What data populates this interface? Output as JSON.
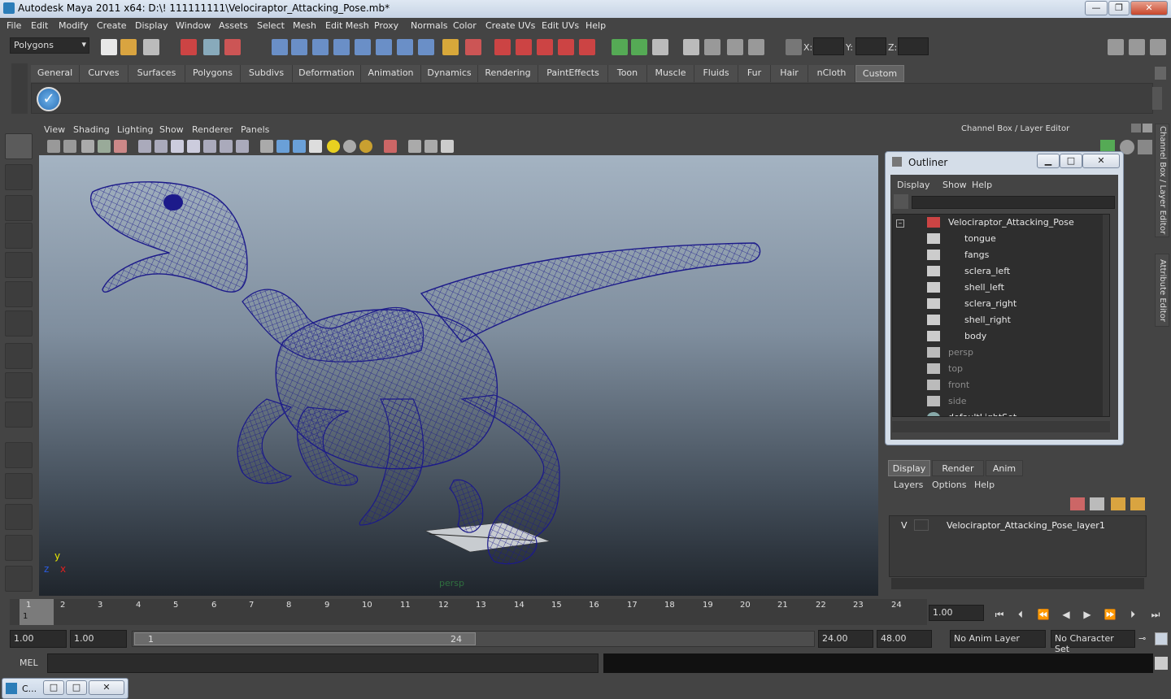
{
  "window": {
    "title": "Autodesk Maya 2011 x64: D:\\! 111111111\\Velociraptor_Attacking_Pose.mb*",
    "min_label": "—",
    "max_label": "❐",
    "close_label": "✕"
  },
  "menubar": [
    "File",
    "Edit",
    "Modify",
    "Create",
    "Display",
    "Window",
    "Assets",
    "Select",
    "Mesh",
    "Edit Mesh",
    "Proxy",
    "Normals",
    "Color",
    "Create UVs",
    "Edit UVs",
    "Help"
  ],
  "status": {
    "mode_menu": "Polygons",
    "x_label": "X:",
    "y_label": "Y:",
    "z_label": "Z:"
  },
  "shelf": {
    "tabs": [
      "General",
      "Curves",
      "Surfaces",
      "Polygons",
      "Subdivs",
      "Deformation",
      "Animation",
      "Dynamics",
      "Rendering",
      "PaintEffects",
      "Toon",
      "Muscle",
      "Fluids",
      "Fur",
      "Hair",
      "nCloth",
      "Custom"
    ],
    "active_tab": "Custom"
  },
  "viewport": {
    "menu": [
      "View",
      "Shading",
      "Lighting",
      "Show",
      "Renderer",
      "Panels"
    ],
    "camera_label": "persp",
    "axis_y": "y",
    "axis_x": "x",
    "axis_z": "z",
    "wire_color": "#1c1a8a"
  },
  "channel_box": {
    "title": "Channel Box / Layer Editor"
  },
  "outliner": {
    "title": "Outliner",
    "min_label": "▁",
    "max_label": "□",
    "close_label": "✕",
    "menu": [
      "Display",
      "Show",
      "Help"
    ],
    "collapse": "–",
    "root": "Velociraptor_Attacking_Pose",
    "children": [
      "tongue",
      "fangs",
      "sclera_left",
      "shell_left",
      "sclera_right",
      "shell_right",
      "body"
    ],
    "cameras": [
      "persp",
      "top",
      "front",
      "side"
    ],
    "sets": [
      "defaultLightSet"
    ]
  },
  "layer_editor": {
    "tabs": [
      "Display",
      "Render",
      "Anim"
    ],
    "active_tab": "Display",
    "menu": [
      "Layers",
      "Options",
      "Help"
    ],
    "layer_visible": "V",
    "layer_name": "Velociraptor_Attacking_Pose_layer1"
  },
  "side_tabs": [
    "Channel Box / Layer Editor",
    "Attribute Editor"
  ],
  "timeline": {
    "ticks": [
      "1",
      "2",
      "3",
      "4",
      "5",
      "6",
      "7",
      "8",
      "9",
      "10",
      "11",
      "12",
      "13",
      "14",
      "15",
      "16",
      "17",
      "18",
      "19",
      "20",
      "21",
      "22",
      "23",
      "24"
    ],
    "current_frame_marker": "1",
    "current_time": "1.00"
  },
  "range": {
    "start": "1.00",
    "playback_start": "1.00",
    "slider_start": "1",
    "slider_end": "24",
    "playback_end": "24.00",
    "end": "48.00",
    "anim_layer": "No Anim Layer",
    "character_set": "No Character Set"
  },
  "command": {
    "label": "MEL"
  },
  "bottom": {
    "label": "C..."
  }
}
